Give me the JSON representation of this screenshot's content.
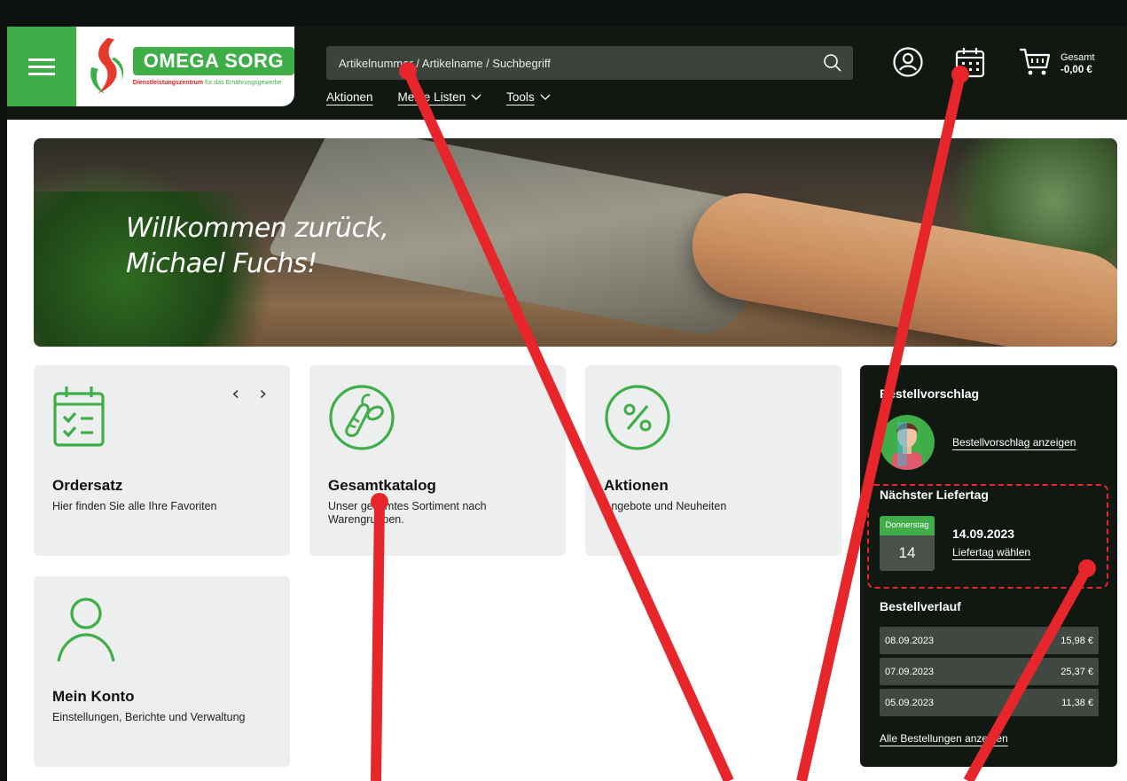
{
  "header": {
    "logo_title": "OMEGA SORG",
    "logo_sub_1": "Dienstleistungszentrum",
    "logo_sub_2": "für das Ernährungsgewerbe",
    "search_placeholder": "Artikelnummer / Artikelname / Suchbegriff",
    "nav": [
      {
        "label": "Aktionen"
      },
      {
        "label": "Meine Listen"
      },
      {
        "label": "Tools"
      }
    ],
    "cart_label": "Gesamt",
    "cart_total": "-0,00 €",
    "icons": [
      "menu-icon",
      "search-icon",
      "user-icon",
      "calendar-icon",
      "cart-icon"
    ]
  },
  "hero": {
    "line1": "Willkommen zurück,",
    "line2": "Michael Fuchs!"
  },
  "tiles": [
    {
      "title": "Ordersatz",
      "desc": "Hier finden Sie alle Ihre Favoriten"
    },
    {
      "title": "Gesamtkatalog",
      "desc": "Unser gesamtes Sortiment nach Warengruppen."
    },
    {
      "title": "Aktionen",
      "desc": "Angebote und Neuheiten"
    },
    {
      "title": "Mein Konto",
      "desc": "Einstellungen, Berichte und Verwaltung"
    }
  ],
  "sidepanel": {
    "suggestion_title": "Bestellvorschlag",
    "suggestion_link": "Bestellvorschlag anzeigen",
    "next_delivery_title": "Nächster Liefertag",
    "weekday": "Donnerstag",
    "day": "14",
    "date": "14.09.2023",
    "choose_link": "Liefertag wählen",
    "history_title": "Bestellverlauf",
    "history": [
      {
        "date": "08.09.2023",
        "amount": "15,98 €"
      },
      {
        "date": "07.09.2023",
        "amount": "25,37 €"
      },
      {
        "date": "05.09.2023",
        "amount": "11,38 €"
      }
    ],
    "all_orders_link": "Alle Bestellungen anzeigen"
  },
  "colors": {
    "brand_green": "#3fae49",
    "header_dark": "#111812",
    "tile_bg": "#ecefed",
    "annotation_red": "#e6262b"
  }
}
